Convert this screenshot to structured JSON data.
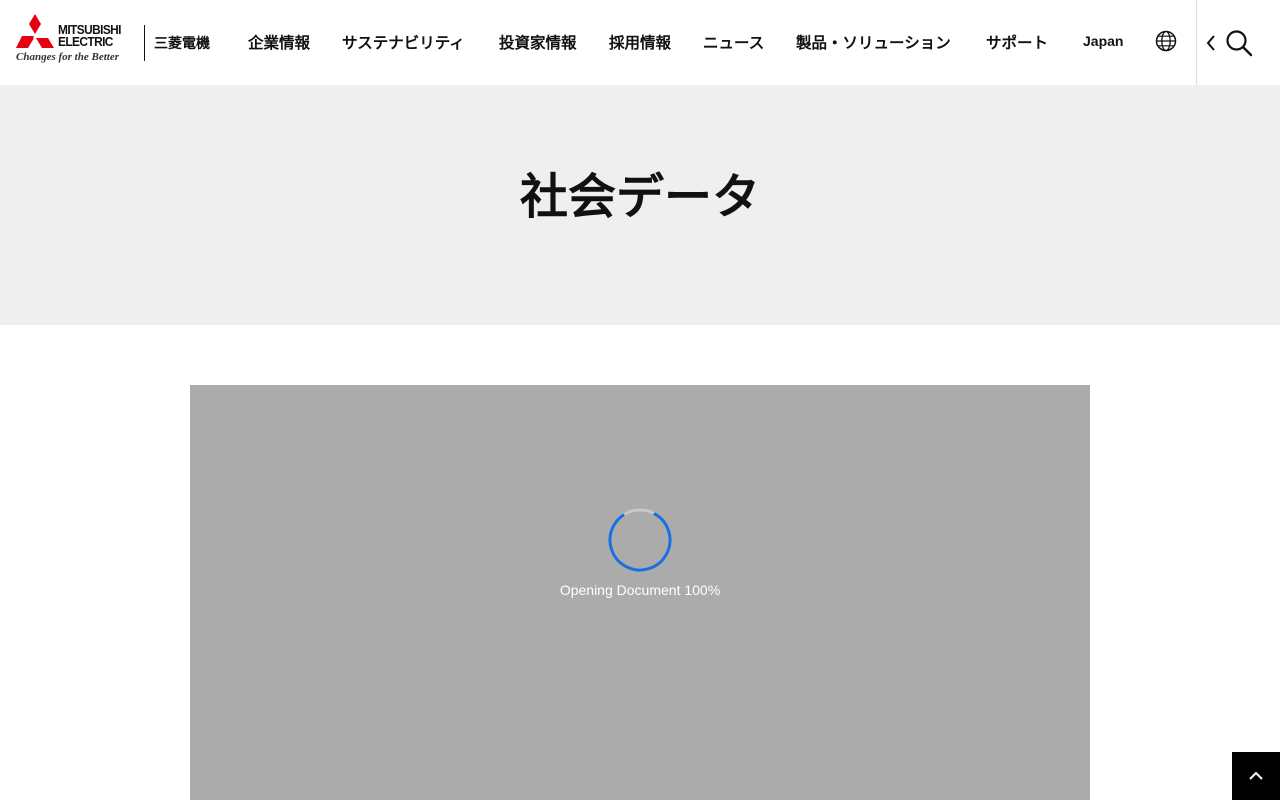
{
  "brand": {
    "name_line1": "MITSUBISHI",
    "name_line2": "ELECTRIC",
    "tagline": "Changes for the Better",
    "name_jp": "三菱電機",
    "logo_color": "#e60012"
  },
  "nav": {
    "items": [
      {
        "label": "企業情報"
      },
      {
        "label": "サステナビリティ"
      },
      {
        "label": "投資家情報"
      },
      {
        "label": "採用情報"
      },
      {
        "label": "ニュース"
      },
      {
        "label": "製品・ソリューション"
      },
      {
        "label": "サポート"
      }
    ],
    "language": "Japan",
    "globe_icon": "globe-icon",
    "back_icon": "chevron-left-icon",
    "search_icon": "search-icon"
  },
  "hero": {
    "title": "社会データ"
  },
  "viewer": {
    "status_text": "Opening Document 100%",
    "progress": 1.0,
    "spinner_color": "#1a6fe0",
    "background": "#ababab"
  },
  "back_to_top": {
    "icon": "chevron-up-icon"
  }
}
